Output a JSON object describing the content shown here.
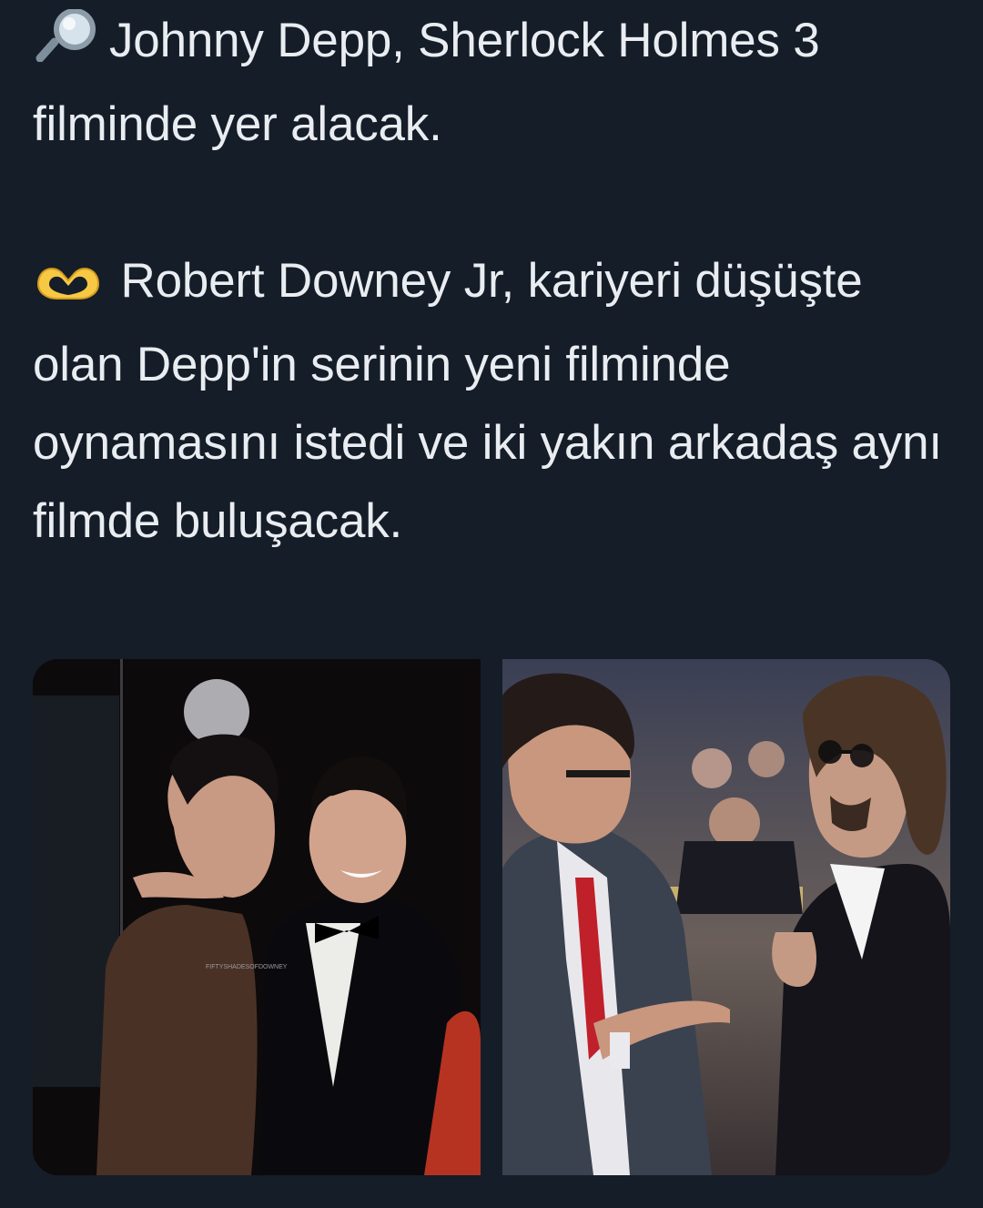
{
  "tweet": {
    "paragraph1": {
      "emoji": "magnifying-glass-emoji",
      "text": "Johnny Depp, Sherlock Holmes 3 filminde yer alacak."
    },
    "paragraph2": {
      "emoji": "heart-hands-emoji",
      "text": "Robert Downey Jr, kariyeri düşüşte olan Depp'in serinin yeni filminde oynamasını istedi ve iki yakın arkadaş aynı filmde buluşacak."
    }
  },
  "media": {
    "photo1": {
      "watermark": "FIFTYSHADESOFDOWNEY"
    },
    "photo2": {}
  },
  "colors": {
    "background": "#151d28",
    "text": "#e9edf1"
  }
}
